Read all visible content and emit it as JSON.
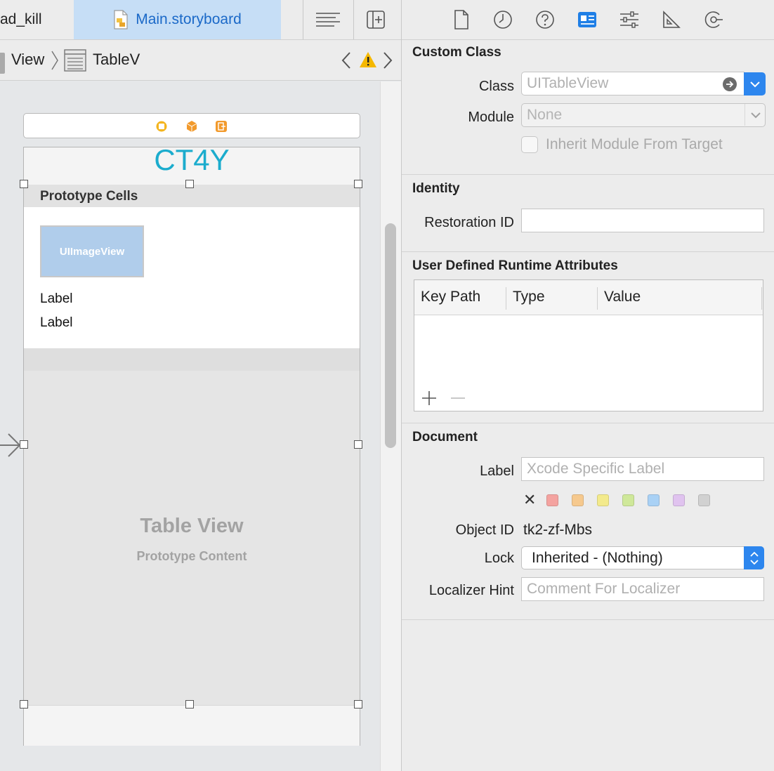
{
  "editor": {
    "tab_inactive": "ad_kill",
    "tab_active": "Main.storyboard"
  },
  "jumpbar": {
    "crumb_view": "View",
    "crumb_tablev": "TableV"
  },
  "scene": {
    "nav_title": "CT4Y",
    "prototype_header": "Prototype Cells",
    "image_view_label": "UIImageView",
    "cell_label_1": "Label",
    "cell_label_2": "Label",
    "tableview_title": "Table View",
    "tableview_subtitle": "Prototype Content"
  },
  "inspector": {
    "custom_class": {
      "title": "Custom Class",
      "class_label": "Class",
      "class_placeholder": "UITableView",
      "module_label": "Module",
      "module_value": "None",
      "inherit_label": "Inherit Module From Target"
    },
    "identity": {
      "title": "Identity",
      "restoration_label": "Restoration ID",
      "restoration_value": ""
    },
    "runtime_attrs": {
      "title": "User Defined Runtime Attributes",
      "col_key_path": "Key Path",
      "col_type": "Type",
      "col_value": "Value",
      "add_symbol": "+",
      "remove_symbol": "—"
    },
    "document": {
      "title": "Document",
      "label_label": "Label",
      "label_placeholder": "Xcode Specific Label",
      "clear_symbol": "✕",
      "swatches": [
        "#f4a3a0",
        "#f6c98e",
        "#f3ea8c",
        "#cfe89a",
        "#a9d1f5",
        "#e0c3ef",
        "#d1d1d1"
      ],
      "object_id_label": "Object ID",
      "object_id_value": "tk2-zf-Mbs",
      "lock_label": "Lock",
      "lock_value": "Inherited - (Nothing)",
      "localizer_label": "Localizer Hint",
      "localizer_placeholder": "Comment For Localizer"
    }
  },
  "colors": {
    "accent_blue": "#2d86ee",
    "nav_title": "#1baccd",
    "warning": "#f5b800"
  }
}
